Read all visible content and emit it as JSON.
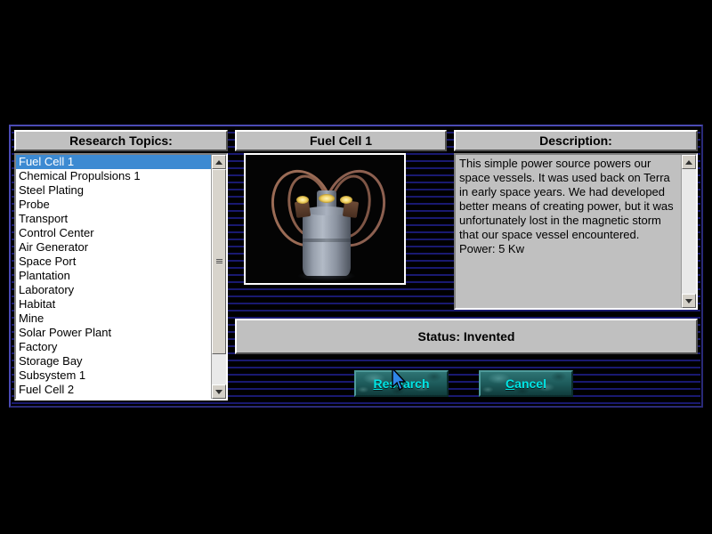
{
  "dialog": {
    "panels": {
      "topics_header": "Research Topics:",
      "item_header": "Fuel Cell 1",
      "description_header": "Description:"
    },
    "topics": [
      {
        "label": "Fuel Cell 1",
        "selected": true
      },
      {
        "label": "Chemical Propulsions 1",
        "selected": false
      },
      {
        "label": "Steel Plating",
        "selected": false
      },
      {
        "label": "Probe",
        "selected": false
      },
      {
        "label": "Transport",
        "selected": false
      },
      {
        "label": "Control Center",
        "selected": false
      },
      {
        "label": "Air Generator",
        "selected": false
      },
      {
        "label": "Space Port",
        "selected": false
      },
      {
        "label": "Plantation",
        "selected": false
      },
      {
        "label": "Laboratory",
        "selected": false
      },
      {
        "label": "Habitat",
        "selected": false
      },
      {
        "label": "Mine",
        "selected": false
      },
      {
        "label": "Solar Power Plant",
        "selected": false
      },
      {
        "label": "Factory",
        "selected": false
      },
      {
        "label": "Storage Bay",
        "selected": false
      },
      {
        "label": "Subsystem 1",
        "selected": false
      },
      {
        "label": "Fuel Cell 2",
        "selected": false
      }
    ],
    "preview": {
      "alt": "fuel-cell-render"
    },
    "description": "This simple power source powers our space vessels.  It was used back on Terra in early space years. We had developed better means of creating power, but it was unfortunately lost in the magnetic storm that our space vessel encountered.  Power: 5 Kw",
    "status": "Status: Invented",
    "buttons": {
      "research": {
        "accel": "R",
        "rest": "esearch"
      },
      "cancel": {
        "accel": "C",
        "rest": "ancel"
      }
    },
    "colors": {
      "selection": "#3c8ad2",
      "button_text": "#00e5e5",
      "panel_face": "#c0c0c0",
      "background_line": "#191970"
    }
  }
}
